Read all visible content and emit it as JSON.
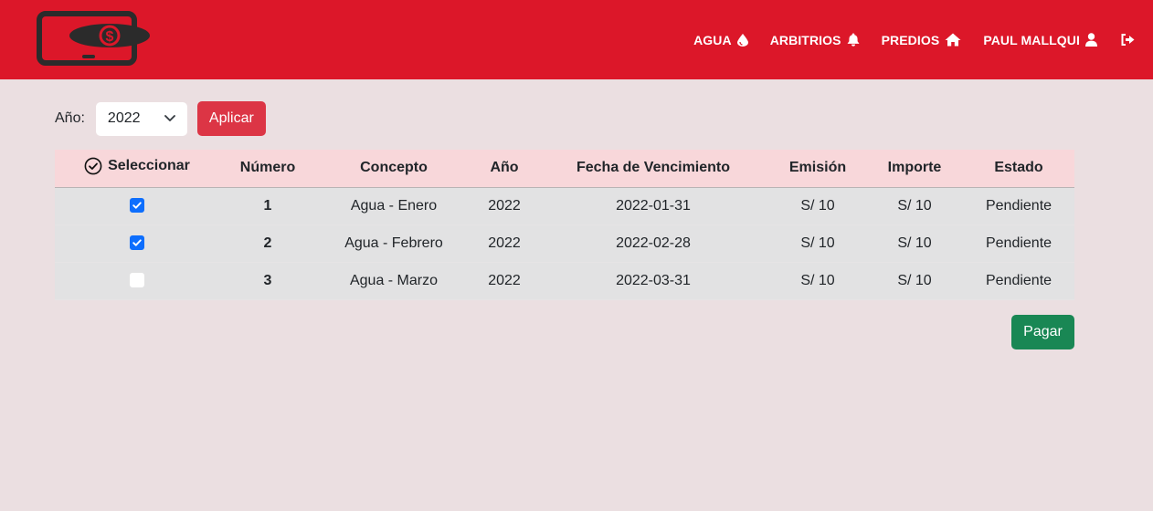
{
  "header": {
    "logo_icon": "phone-dollar-logo",
    "nav": [
      {
        "label": "AGUA",
        "icon": "droplet-icon"
      },
      {
        "label": "ARBITRIOS",
        "icon": "bell-icon"
      },
      {
        "label": "PREDIOS",
        "icon": "home-icon"
      },
      {
        "label": "PAUL MALLQUI",
        "icon": "user-icon"
      }
    ],
    "logout_icon": "logout-icon"
  },
  "filter": {
    "label": "Año:",
    "selected_year": "2022",
    "apply_label": "Aplicar"
  },
  "table": {
    "headers": [
      "Seleccionar",
      "Número",
      "Concepto",
      "Año",
      "Fecha de Vencimiento",
      "Emisión",
      "Importe",
      "Estado"
    ],
    "rows": [
      {
        "checked": true,
        "numero": "1",
        "concepto": "Agua - Enero",
        "anio": "2022",
        "vencimiento": "2022-01-31",
        "emision": "S/ 10",
        "importe": "S/ 10",
        "estado": "Pendiente"
      },
      {
        "checked": true,
        "numero": "2",
        "concepto": "Agua - Febrero",
        "anio": "2022",
        "vencimiento": "2022-02-28",
        "emision": "S/ 10",
        "importe": "S/ 10",
        "estado": "Pendiente"
      },
      {
        "checked": false,
        "numero": "3",
        "concepto": "Agua - Marzo",
        "anio": "2022",
        "vencimiento": "2022-03-31",
        "emision": "S/ 10",
        "importe": "S/ 10",
        "estado": "Pendiente"
      }
    ]
  },
  "pay_label": "Pagar",
  "colors": {
    "navbar": "#dc1729",
    "background": "#ebdfe1",
    "apply_button": "#dc3545",
    "pay_button": "#198754",
    "table_header": "#f8d7da",
    "checkbox_checked": "#0d6efd"
  }
}
